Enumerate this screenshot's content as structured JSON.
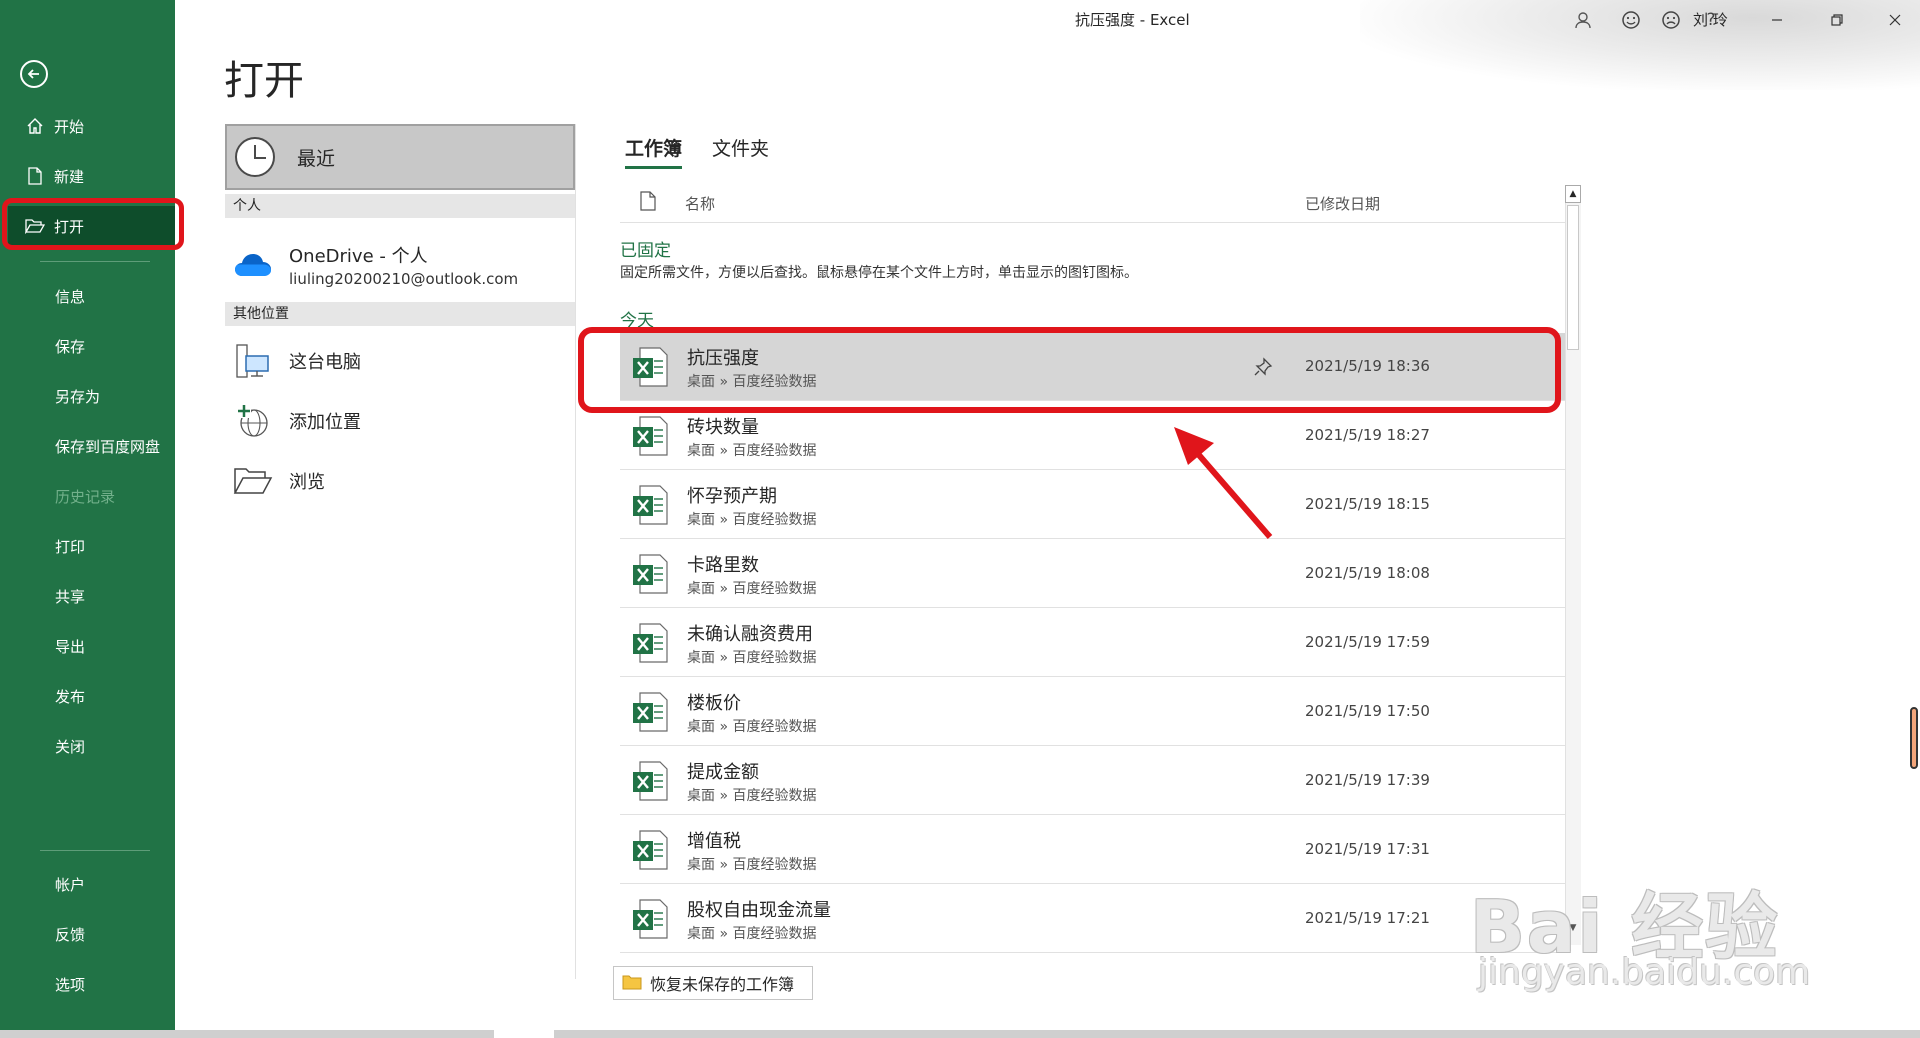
{
  "window": {
    "title": "抗压强度  -  Excel",
    "user": "刘 玲"
  },
  "sidebar": {
    "top_items": [
      {
        "label": "开始"
      },
      {
        "label": "新建"
      },
      {
        "label": "打开"
      }
    ],
    "mid_items": [
      {
        "label": "信息"
      },
      {
        "label": "保存"
      },
      {
        "label": "另存为"
      },
      {
        "label": "保存到百度网盘"
      },
      {
        "label": "历史记录"
      },
      {
        "label": "打印"
      },
      {
        "label": "共享"
      },
      {
        "label": "导出"
      },
      {
        "label": "发布"
      },
      {
        "label": "关闭"
      }
    ],
    "bottom_items": [
      {
        "label": "帐户"
      },
      {
        "label": "反馈"
      },
      {
        "label": "选项"
      }
    ]
  },
  "page_title": "打开",
  "locations": {
    "recent": "最近",
    "personal_header": "个人",
    "onedrive_title": "OneDrive - 个人",
    "onedrive_email": "liuling20200210@outlook.com",
    "other_header": "其他位置",
    "this_pc": "这台电脑",
    "add_place": "添加位置",
    "browse": "浏览"
  },
  "tabs": {
    "workbooks": "工作簿",
    "folders": "文件夹"
  },
  "list": {
    "col_name": "名称",
    "col_date": "已修改日期",
    "pinned_title": "已固定",
    "pinned_desc": "固定所需文件，方便以后查找。鼠标悬停在某个文件上方时，单击显示的图钉图标。",
    "today_title": "今天",
    "files": [
      {
        "name": "抗压强度",
        "path": "桌面 » 百度经验数据",
        "date": "2021/5/19 18:36"
      },
      {
        "name": "砖块数量",
        "path": "桌面 » 百度经验数据",
        "date": "2021/5/19 18:27"
      },
      {
        "name": "怀孕预产期",
        "path": "桌面 » 百度经验数据",
        "date": "2021/5/19 18:15"
      },
      {
        "name": "卡路里数",
        "path": "桌面 » 百度经验数据",
        "date": "2021/5/19 18:08"
      },
      {
        "name": "未确认融资费用",
        "path": "桌面 » 百度经验数据",
        "date": "2021/5/19 17:59"
      },
      {
        "name": "楼板价",
        "path": "桌面 » 百度经验数据",
        "date": "2021/5/19 17:50"
      },
      {
        "name": "提成金额",
        "path": "桌面 » 百度经验数据",
        "date": "2021/5/19 17:39"
      },
      {
        "name": "增值税",
        "path": "桌面 » 百度经验数据",
        "date": "2021/5/19 17:31"
      },
      {
        "name": "股权自由现金流量",
        "path": "桌面 » 百度经验数据",
        "date": "2021/5/19 17:21"
      }
    ]
  },
  "recover_button": "恢复未保存的工作簿",
  "watermark": {
    "main": "Bai 经验",
    "sub": "jingyan.baidu.com"
  },
  "colors": {
    "accent": "#217346",
    "highlight": "#e0151b"
  }
}
